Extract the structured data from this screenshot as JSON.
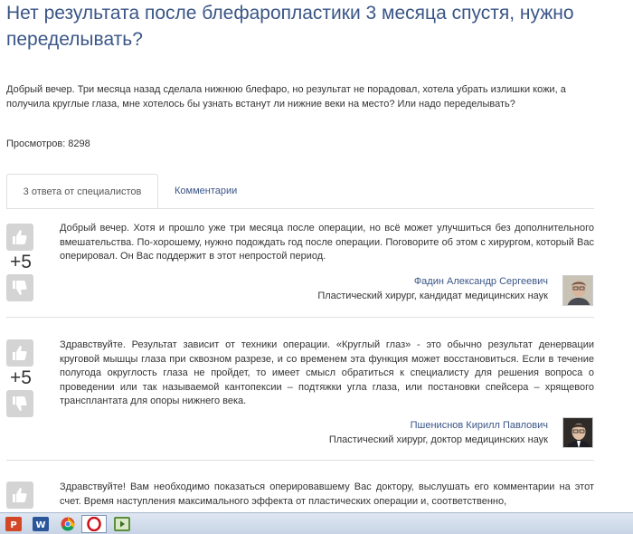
{
  "page": {
    "title": "Нет результата после блефаропластики 3 месяца спустя, нужно переделывать?",
    "question": "Добрый вечер. Три месяца назад сделала нижнюю блефаро, но результат не порадовал, хотела убрать излишки кожи, а получила круглые глаза, мне хотелось бы узнать встанут ли нижние веки на место? Или надо переделывать?",
    "views": "Просмотров: 8298"
  },
  "tabs": [
    {
      "label": "3 ответа от специалистов",
      "active": true
    },
    {
      "label": "Комментарии",
      "active": false
    }
  ],
  "answers": [
    {
      "score": "+5",
      "text": "Добрый вечер. Хотя и прошло уже три месяца после операции, но всё может улучшиться без дополнительного вмешательства. По-хорошему, нужно подождать год после операции. Поговорите об этом с хирургом, который Вас оперировал. Он Вас поддержит в этот непростой период.",
      "author_name": "Фадин Александр Сергеевич",
      "author_role": "Пластический хирург, кандидат медицинских наук"
    },
    {
      "score": "+5",
      "text": "Здравствуйте. Результат зависит от техники операции. «Круглый глаз» - это обычно результат денервации круговой мышцы глаза при сквозном разрезе, и со временем эта функция может восстановиться. Если в течение полугода округлость глаза не пройдет, то имеет смысл обратиться к специалисту для решения вопроса о проведении или так называемой кантопексии – подтяжки угла глаза, или постановки спейсера – хрящевого трансплантата для опоры нижнего века.",
      "author_name": "Пшениснов Кирилл Павлович",
      "author_role": "Пластический хирург, доктор медицинских наук"
    },
    {
      "score": "",
      "text": "Здравствуйте! Вам необходимо показаться оперировавшему Вас доктору, выслушать его комментарии на этот счет. Время наступления максимального эффекта от пластических операции и, соответственно,",
      "author_name": "",
      "author_role": ""
    }
  ],
  "taskbar": {
    "apps": [
      "powerpoint-icon",
      "word-icon",
      "chrome-icon",
      "opera-icon",
      "media-player-icon"
    ],
    "active_index": 3
  },
  "colors": {
    "title": "#3a5687",
    "link": "#3a5687",
    "vote_button": "#d4d4d4"
  }
}
